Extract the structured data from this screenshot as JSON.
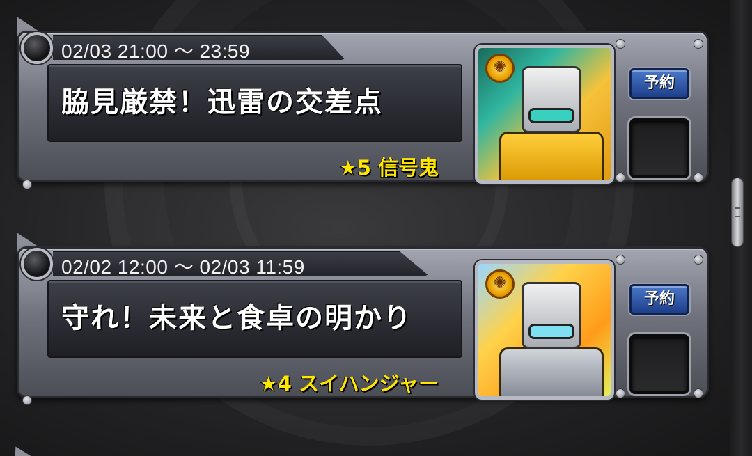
{
  "quests": [
    {
      "time": "02/03 21:00 ～ 23:59",
      "title": "脇見厳禁！迅雷の交差点",
      "boss": "★5 信号鬼",
      "reserve_label": "予約"
    },
    {
      "time": "02/02 12:00 ～ 02/03 11:59",
      "title": "守れ！未来と食卓の明かり",
      "boss": "★4 スイハンジャー",
      "reserve_label": "予約"
    }
  ],
  "icons": {
    "medal": "sun-medal-icon",
    "portrait_1": "traffic-signal-robot-monster-icon",
    "portrait_2": "rice-cooker-robot-monster-icon"
  },
  "colors": {
    "boss_text": "#ffe600",
    "reserve_button": "#2b54a8",
    "card_frame": "#7a7d86"
  }
}
